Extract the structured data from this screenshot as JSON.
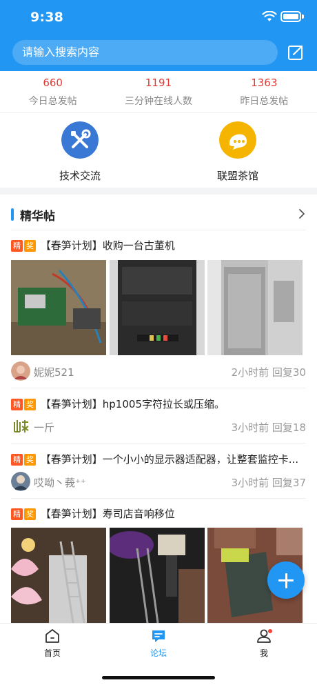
{
  "status_bar": {
    "time": "9:38"
  },
  "search": {
    "placeholder": "请输入搜索内容"
  },
  "stats": [
    {
      "value": "660",
      "label": "今日总发帖"
    },
    {
      "value": "1191",
      "label": "三分钟在线人数"
    },
    {
      "value": "1363",
      "label": "昨日总发帖"
    }
  ],
  "categories": [
    {
      "label": "技术交流",
      "icon": "tools-icon",
      "color": "#3a78d6"
    },
    {
      "label": "联盟茶馆",
      "icon": "chat-bubble-icon",
      "color": "#f5b400"
    }
  ],
  "section": {
    "title": "精华帖"
  },
  "tags": {
    "jing": "精",
    "jiang": "奖"
  },
  "posts": [
    {
      "title": "【春笋计划】收购一台古董机",
      "author": "妮妮521",
      "info": "2小时前 回复30"
    },
    {
      "title": "【春笋计划】hp1005字符拉长或压缩。",
      "author": "一斤",
      "info": "3小时前 回复18"
    },
    {
      "title": "【春笋计划】一个小小的显示器适配器，让整套监控卡...",
      "author": "哎呦丶莪⁺⁺",
      "info": "3小时前 回复37"
    },
    {
      "title": "【春笋计划】寿司店音响移位"
    }
  ],
  "tabbar": {
    "home": "首页",
    "forum": "论坛",
    "me": "我"
  },
  "colors": {
    "primary": "#2196f3",
    "accent_red": "#e53935"
  }
}
